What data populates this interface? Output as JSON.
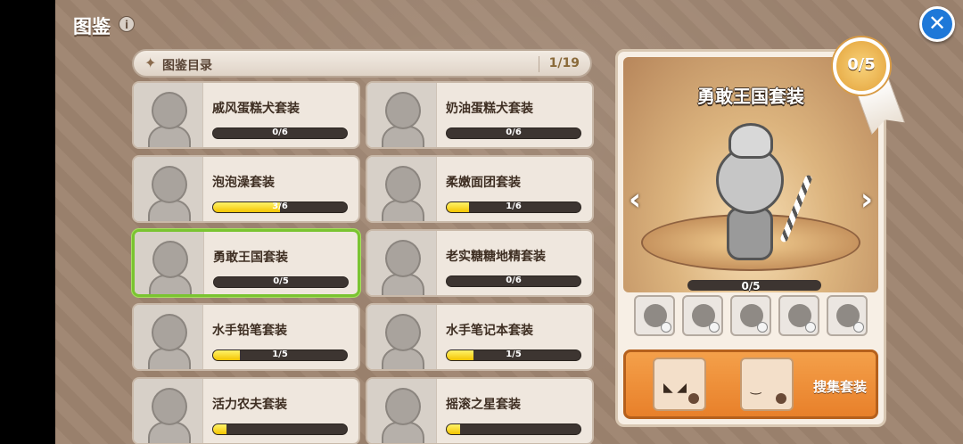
{
  "header": {
    "title": "图鉴",
    "info_icon": "i",
    "close_icon": "✕"
  },
  "catalog": {
    "label": "图鉴目录",
    "count": "1/19"
  },
  "sets": [
    {
      "name": "戚风蛋糕犬套装",
      "progress": "0/6",
      "fraction": 0
    },
    {
      "name": "奶油蛋糕犬套装",
      "progress": "0/6",
      "fraction": 0
    },
    {
      "name": "泡泡澡套装",
      "progress": "3/6",
      "fraction": 0.5
    },
    {
      "name": "柔嫩面团套装",
      "progress": "1/6",
      "fraction": 0.1667
    },
    {
      "name": "勇敢王国套装",
      "progress": "0/5",
      "fraction": 0,
      "selected": true
    },
    {
      "name": "老实糖糖地精套装",
      "progress": "0/6",
      "fraction": 0
    },
    {
      "name": "水手铅笔套装",
      "progress": "1/5",
      "fraction": 0.2
    },
    {
      "name": "水手笔记本套装",
      "progress": "1/5",
      "fraction": 0.2
    },
    {
      "name": "活力农夫套装",
      "progress": "",
      "fraction": 0.1
    },
    {
      "name": "摇滚之星套装",
      "progress": "",
      "fraction": 0.1
    }
  ],
  "detail": {
    "title": "勇敢王国套装",
    "medal": "0/5",
    "progress": "0/5",
    "collect_label": "搜集套装",
    "prev_icon": "‹",
    "next_icon": "›"
  },
  "colors": {
    "accent": "#7ac431",
    "close": "#1e78d8",
    "fill": "#f4c400"
  }
}
